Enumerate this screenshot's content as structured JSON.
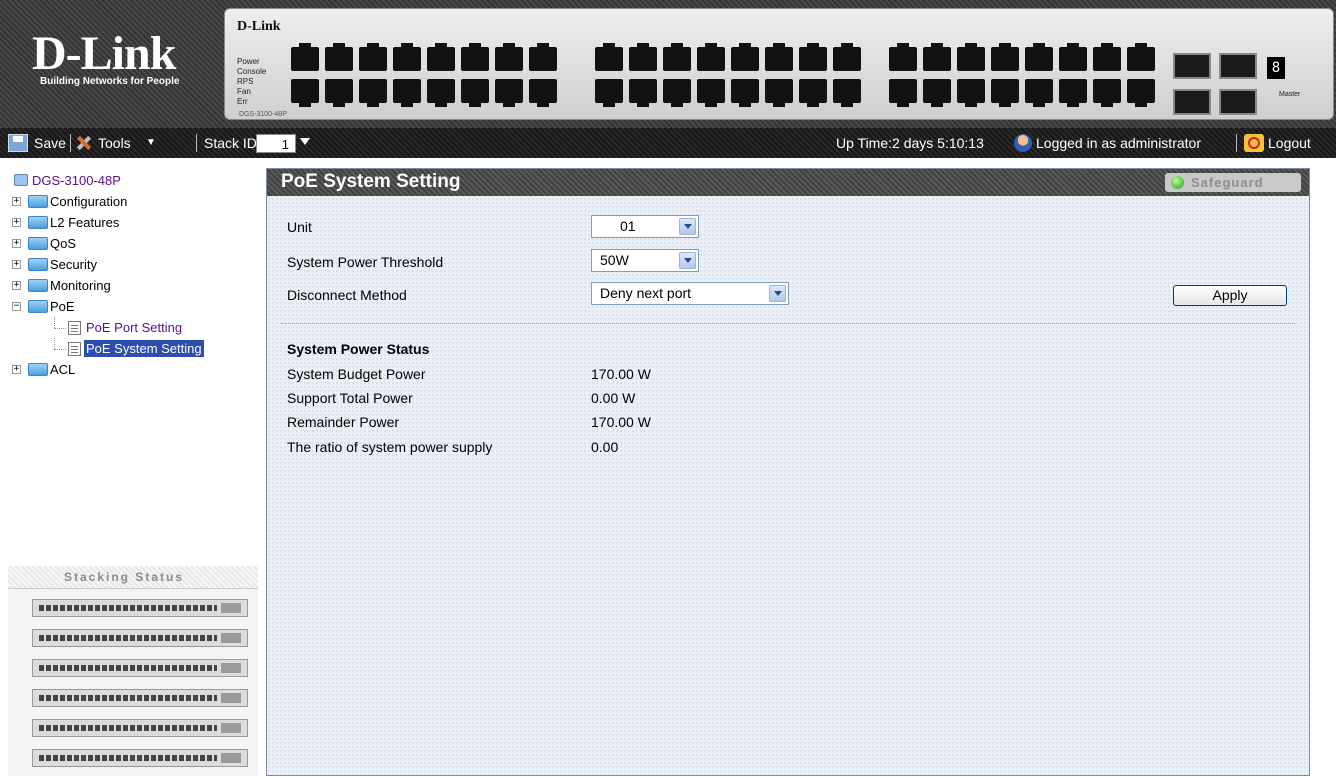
{
  "banner": {
    "logo_text": "D-Link",
    "logo_tagline": "Building Networks for People",
    "device_brand": "D-Link",
    "device_leds": [
      "Power",
      "Console",
      "RPS",
      "Fan",
      "Err"
    ],
    "device_model": "DGS-3100-48P",
    "master_label": "Master"
  },
  "toolbar": {
    "save_label": "Save",
    "tools_label": "Tools",
    "stack_id_label": "Stack ID",
    "stack_id_value": "1",
    "uptime_text": "Up Time:2 days 5:10:13",
    "logged_in_text": "Logged in as administrator",
    "logout_label": "Logout"
  },
  "tree": {
    "root": "DGS-3100-48P",
    "items": [
      {
        "label": "Configuration",
        "expander": "+"
      },
      {
        "label": "L2 Features",
        "expander": "+"
      },
      {
        "label": "QoS",
        "expander": "+"
      },
      {
        "label": "Security",
        "expander": "+"
      },
      {
        "label": "Monitoring",
        "expander": "+"
      },
      {
        "label": "PoE",
        "expander": "−"
      },
      {
        "label": "ACL",
        "expander": "+"
      }
    ],
    "poe_children": [
      "PoE Port Setting",
      "PoE System Setting"
    ]
  },
  "stacking": {
    "title": "Stacking Status"
  },
  "main": {
    "title": "PoE System Setting",
    "safeguard_label": "Safeguard",
    "form": {
      "unit_label": "Unit",
      "unit_value": "01",
      "threshold_label": "System Power Threshold",
      "threshold_value": "50W",
      "disconnect_label": "Disconnect Method",
      "disconnect_value": "Deny next port",
      "apply_label": "Apply"
    },
    "status": {
      "heading": "System Power Status",
      "rows": [
        {
          "label": "System Budget Power",
          "value": "170.00 W"
        },
        {
          "label": "Support Total Power",
          "value": "0.00 W"
        },
        {
          "label": "Remainder Power",
          "value": "170.00 W"
        },
        {
          "label": "The ratio of system power supply",
          "value": "0.00"
        }
      ]
    }
  },
  "colors": {
    "selected_bg": "#2c4eb0",
    "tree_link": "#5a0f8c",
    "header_bg": "#505050"
  }
}
